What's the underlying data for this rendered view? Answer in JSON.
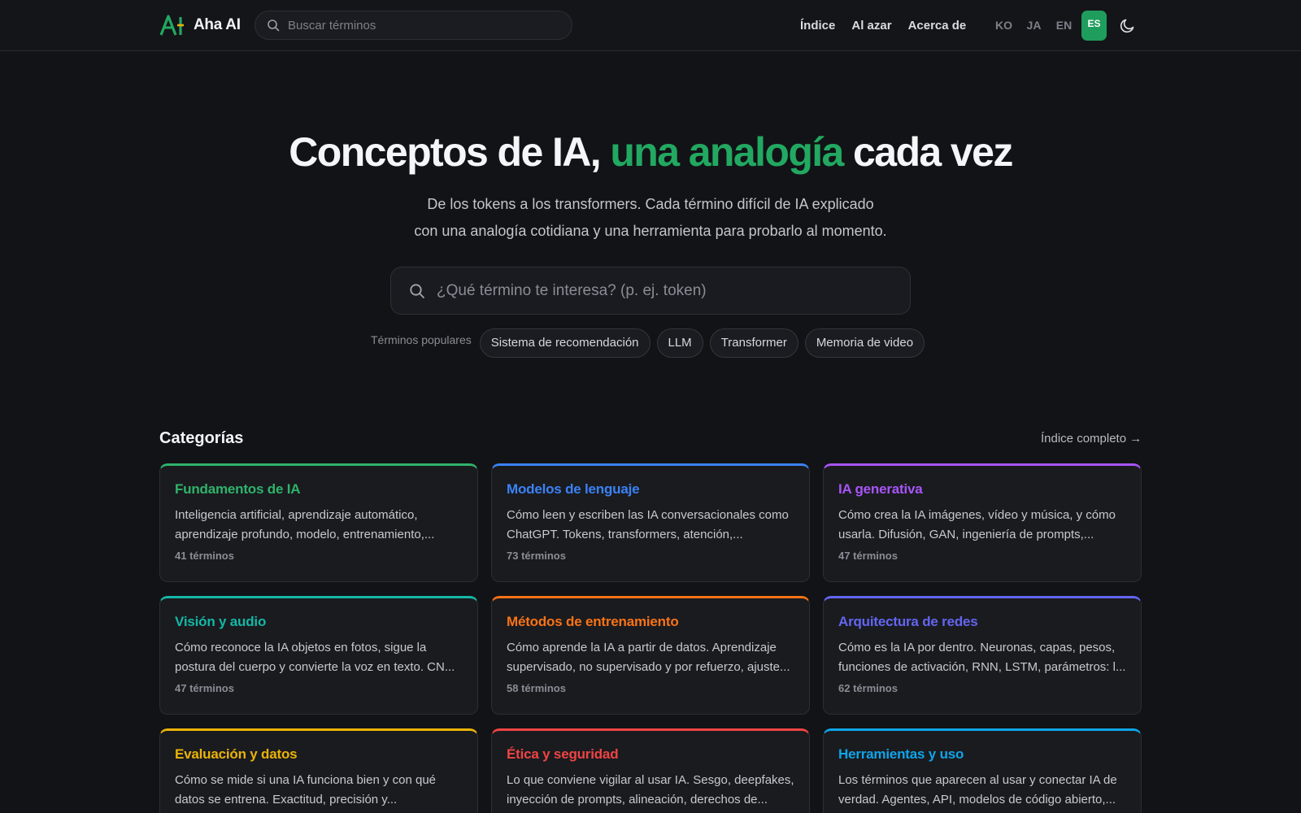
{
  "nav": {
    "brand": "Aha AI",
    "search_placeholder": "Buscar términos",
    "links": [
      "Índice",
      "Al azar",
      "Acerca de"
    ],
    "languages": [
      "KO",
      "JA",
      "EN",
      "ES"
    ],
    "active_language": "ES",
    "theme_icon": "moon-icon"
  },
  "hero": {
    "title_pre": "Conceptos de IA, ",
    "title_accent": "una analogía",
    "title_post": " cada vez",
    "subtitle_line1": "De los tokens a los transformers. Cada término difícil de IA explicado",
    "subtitle_line2": "con una analogía cotidiana y una herramienta para probarlo al momento.",
    "search_placeholder": "¿Qué término te interesa? (p. ej. token)",
    "popular_label": "Términos populares",
    "popular_terms": [
      "Sistema de recomendación",
      "LLM",
      "Transformer",
      "Memoria de video"
    ]
  },
  "categories": {
    "title": "Categorías",
    "index_link": "Índice completo →",
    "items": [
      {
        "title": "Fundamentos de IA",
        "desc": "Inteligencia artificial, aprendizaje automático, aprendizaje profundo, modelo, entrenamiento,...",
        "count": "41 términos",
        "color": "#2fb36b"
      },
      {
        "title": "Modelos de lenguaje",
        "desc": "Cómo leen y escriben las IA conversacionales como ChatGPT. Tokens, transformers, atención,...",
        "count": "73 términos",
        "color": "#3b82f6"
      },
      {
        "title": "IA generativa",
        "desc": "Cómo crea la IA imágenes, vídeo y música, y cómo usarla. Difusión, GAN, ingeniería de prompts,...",
        "count": "47 términos",
        "color": "#a855f7"
      },
      {
        "title": "Visión y audio",
        "desc": "Cómo reconoce la IA objetos en fotos, sigue la postura del cuerpo y convierte la voz en texto. CN...",
        "count": "47 términos",
        "color": "#14b8a6"
      },
      {
        "title": "Métodos de entrenamiento",
        "desc": "Cómo aprende la IA a partir de datos. Aprendizaje supervisado, no supervisado y por refuerzo, ajuste...",
        "count": "58 términos",
        "color": "#f97316"
      },
      {
        "title": "Arquitectura de redes",
        "desc": "Cómo es la IA por dentro. Neuronas, capas, pesos, funciones de activación, RNN, LSTM, parámetros: l...",
        "count": "62 términos",
        "color": "#6366f1"
      },
      {
        "title": "Evaluación y datos",
        "desc": "Cómo se mide si una IA funciona bien y con qué datos se entrena. Exactitud, precisión y...",
        "count": "",
        "color": "#eab308"
      },
      {
        "title": "Ética y seguridad",
        "desc": "Lo que conviene vigilar al usar IA. Sesgo, deepfakes, inyección de prompts, alineación, derechos de...",
        "count": "",
        "color": "#ef4444"
      },
      {
        "title": "Herramientas y uso",
        "desc": "Los términos que aparecen al usar y conectar IA de verdad. Agentes, API, modelos de código abierto,...",
        "count": "",
        "color": "#0ea5e9"
      }
    ]
  }
}
